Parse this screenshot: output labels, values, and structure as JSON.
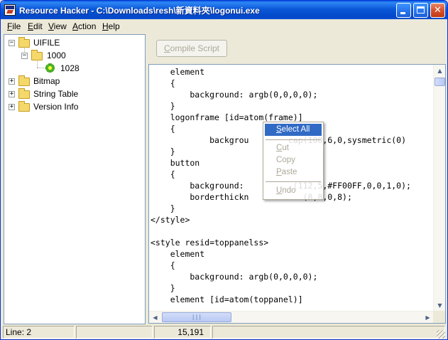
{
  "window": {
    "title": "Resource Hacker  -  C:\\Downloads\\resh\\新資料夾\\logonui.exe"
  },
  "title_buttons": {
    "minimize": "minimize-icon",
    "maximize": "maximize-icon",
    "close": "close-icon",
    "close_glyph": "✕"
  },
  "menubar": {
    "items": [
      {
        "key": "F",
        "rest": "ile"
      },
      {
        "key": "E",
        "rest": "dit"
      },
      {
        "key": "V",
        "rest": "iew"
      },
      {
        "key": "A",
        "rest": "ction"
      },
      {
        "key": "H",
        "rest": "elp"
      }
    ]
  },
  "tree": {
    "nodes": [
      {
        "label": "UIFILE",
        "expander": "−"
      },
      {
        "label": "1000",
        "expander": "−"
      },
      {
        "label": "1028"
      },
      {
        "label": "Bitmap",
        "expander": "+"
      },
      {
        "label": "String Table",
        "expander": "+"
      },
      {
        "label": "Version Info",
        "expander": "+"
      }
    ]
  },
  "toolbar": {
    "compile_key": "C",
    "compile_rest": "ompile Script"
  },
  "editor": {
    "lines": [
      "    element",
      "    {",
      "        background: argb(0,0,0,0);",
      "    }",
      "    logonframe [id=atom(frame)]",
      "    {",
      "            backgrou        cap(100,6,0,sysmetric(0)",
      "    }",
      "    button",
      "    {",
      "        background:          (112,5,#FF00FF,0,0,1,0);",
      "        borderthickn           (8,8,0,8);",
      "    }",
      "</style>",
      "",
      "<style resid=toppanelss>",
      "    element",
      "    {",
      "        background: argb(0,0,0,0);",
      "    }",
      "    element [id=atom(toppanel)]"
    ],
    "scroll_up": "▲",
    "scroll_down": "▼",
    "scroll_left": "◀",
    "scroll_right": "▶",
    "thumb_grip": "|||"
  },
  "context_menu": {
    "items": [
      {
        "key": "S",
        "rest": "elect All",
        "enabled": true
      },
      {
        "key": "C",
        "rest": "ut",
        "enabled": false
      },
      {
        "key": "C",
        "rest": "opy",
        "enabled": false
      },
      {
        "key": "P",
        "rest": "aste",
        "enabled": false
      },
      {
        "key": "U",
        "rest": "ndo",
        "enabled": false
      }
    ]
  },
  "status": {
    "line": "Line: 2",
    "position": "15,191"
  },
  "colors": {
    "title_bar": "#0348c8",
    "menu_highlight": "#316ac5",
    "disabled_text": "#aca899"
  }
}
